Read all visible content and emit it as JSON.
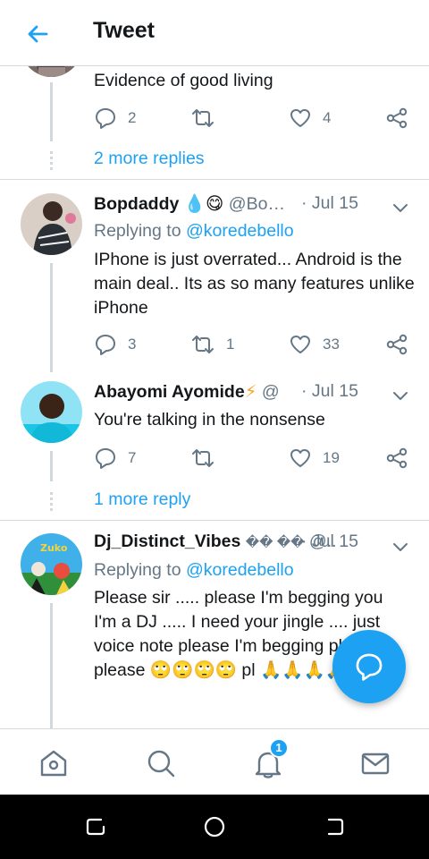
{
  "header": {
    "title": "Tweet",
    "back_icon": "arrow-left-icon"
  },
  "tweets": [
    {
      "text": "Evidence of good living",
      "replies": "2",
      "retweets": "",
      "likes": "4",
      "more_replies": "2 more replies"
    },
    {
      "name": "Bopdaddy",
      "name_emoji": "💧😋",
      "handle": "@Bo…",
      "date": "· Jul 15",
      "replying_prefix": "Replying to",
      "replying_handle": "@koredebello",
      "text": "IPhone is just overrated... Android is the main deal.. Its as so many features unlike iPhone",
      "replies": "3",
      "retweets": "1",
      "likes": "33"
    },
    {
      "name": "Abayomi Ayomide",
      "name_emoji": "⚡",
      "handle": "@",
      "date": "· Jul 15",
      "text": "You're talking in the nonsense",
      "replies": "7",
      "retweets": "",
      "likes": "19",
      "more_replies": "1 more reply"
    },
    {
      "name": "Dj_Distinct_Vibes",
      "name_emoji": "�� ��",
      "handle": "@..",
      "date": "· Jul 15",
      "replying_prefix": "Replying to",
      "replying_handle": "@koredebello",
      "text": "Please sir ..... please I'm begging you I'm a DJ ..... I need your jingle .... just voice note please I'm begging please please 🙄🙄🙄🙄 pl 🙏🙏🙏🙏🙏"
    }
  ],
  "tabbar": {
    "items": [
      "home-icon",
      "search-icon",
      "notifications-icon",
      "messages-icon"
    ],
    "notification_count": "1"
  },
  "colors": {
    "accent": "#1da1f2",
    "secondary_text": "#657786",
    "divider": "#d5dce1"
  }
}
